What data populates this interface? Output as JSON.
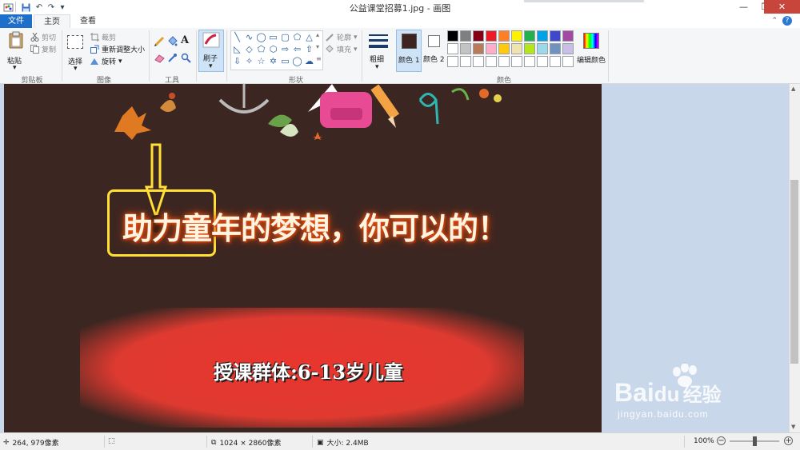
{
  "window": {
    "title": "公益课堂招募1.jpg - 画图"
  },
  "tabs": {
    "file": "文件",
    "home": "主页",
    "view": "查看"
  },
  "clipboard": {
    "paste": "粘贴",
    "cut": "剪切",
    "copy": "复制",
    "group": "剪贴板"
  },
  "image": {
    "select": "选择",
    "crop": "裁剪",
    "resize": "重新调整大小",
    "rotate": "旋转",
    "group": "图像"
  },
  "tools": {
    "group": "工具",
    "brush": "刷子",
    "text_glyph": "A"
  },
  "shapes": {
    "outline": "轮廓",
    "fill": "填充",
    "group": "形状"
  },
  "size": {
    "label": "粗细"
  },
  "colors": {
    "color1": "颜色 1",
    "color2": "颜色 2",
    "edit": "编辑颜色",
    "group": "颜色",
    "color1_value": "#3e2420",
    "color2_value": "#ffffff",
    "palette_row1": [
      "#000000",
      "#7f7f7f",
      "#880015",
      "#ed1c24",
      "#ff7f27",
      "#fff200",
      "#22b14c",
      "#00a2e8",
      "#3f48cc",
      "#a349a4"
    ],
    "palette_row2": [
      "#ffffff",
      "#c3c3c3",
      "#b97a57",
      "#ffaec9",
      "#ffc90e",
      "#efe4b0",
      "#b5e61d",
      "#99d9ea",
      "#7092be",
      "#c8bfe7"
    ]
  },
  "canvas": {
    "headline": "助力童年的梦想，你可以的！",
    "subline": "授课群体:6-13岁儿童",
    "watermark_brand": "Bai",
    "watermark_brand2": "du",
    "watermark_cn": "经验",
    "watermark_url": "jingyan.baidu.com"
  },
  "status": {
    "cursor_pos": "264, 979像素",
    "image_size": "1024 × 2860像素",
    "file_size": "大小: 2.4MB",
    "zoom": "100%"
  }
}
